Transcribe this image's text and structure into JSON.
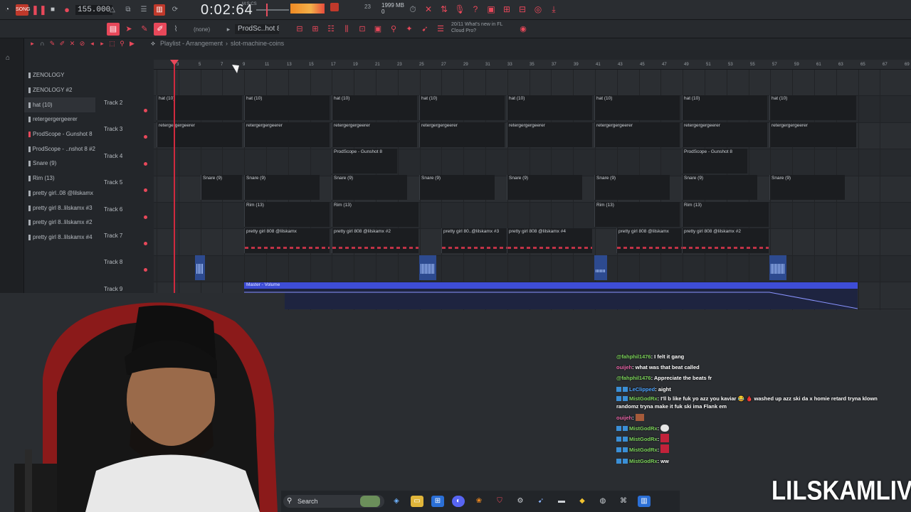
{
  "transport": {
    "tempo": "155.000",
    "time": "0:02:64",
    "time_sub": "M:S:CS",
    "cpu_num": "23",
    "ram": "1999 MB",
    "ram_sub": "0"
  },
  "toolbar": {
    "snap": "(none)",
    "pattern": "ProdSc..hot 8",
    "news_line1": "20/11  What's new in FL",
    "news_line2": "Cloud Pro?"
  },
  "playlist": {
    "title": "Playlist - Arrangement",
    "arrangement": "slot-machine-coins"
  },
  "browser": {
    "items": [
      "ZENOLOGY",
      "ZENOLOGY #2",
      "hat (10)",
      "retergergerg­eerer",
      "ProdScope - Gunshot 8",
      "ProdScope - ..nshot 8 #2",
      "Snare (9)",
      "Rim (13)",
      "pretty girl..08 @lilskamx",
      "pretty girl 8..lilskamx #3",
      "pretty girl 8..lilskamx #2",
      "pretty girl 8..lilskamx #4"
    ]
  },
  "ruler": [
    "3",
    "5",
    "7",
    "9",
    "11",
    "13",
    "15",
    "17",
    "19",
    "21",
    "23",
    "25",
    "27",
    "29",
    "31",
    "33",
    "35",
    "37",
    "39",
    "41",
    "43",
    "45",
    "47",
    "49",
    "51",
    "53",
    "55",
    "57",
    "59",
    "61",
    "63",
    "65",
    "67",
    "69"
  ],
  "tracks": [
    {
      "name": "Track 2"
    },
    {
      "name": "Track 3"
    },
    {
      "name": "Track 4"
    },
    {
      "name": "Track 5"
    },
    {
      "name": "Track 6"
    },
    {
      "name": "Track 7"
    },
    {
      "name": "Track 8"
    },
    {
      "name": "Track 9"
    }
  ],
  "clips": {
    "hat": "hat (10)",
    "reter": "retergergergeerer",
    "prod": "ProdScope - Gunshot 8",
    "snare": "Snare (9)",
    "rim": "Rim (13)",
    "pg1": "pretty girl 808 @lilskamx",
    "pg2": "pretty girl 808 @lilskamx #2",
    "pg3": "pretty girl 80..@lilskamx #3",
    "pg4": "pretty girl 808 @lilskamx #4",
    "auto": "Master - Volume"
  },
  "chat": {
    "l0_user": "@fahphil1476",
    "l0_msg": ": I felt it gang",
    "l1_user": "ouijeh",
    "l1_msg": ": what was that beat called",
    "l2_user": "@fahphil1476",
    "l2_msg": ": Appreciate the beats fr",
    "l3_user": "LeClipped",
    "l3_msg": ": aight",
    "l4_user": "MistGodRx",
    "l4_msg": ": I'll b like fuk yo azz you kaviar 😂 🩸 washed up azz ski da x homie retard tryna klown randomz tryna make it fuk ski ima Flank em",
    "l5_user": "ouijeh",
    "l5_msg": ":",
    "l6_user": "MistGodRx",
    "l6_msg": ":",
    "l7_user": "MistGodRx",
    "l7_msg": ":",
    "l8_user": "MistGodRx",
    "l8_msg": ":",
    "l9_user": "MistGodRx",
    "l9_msg": ": ww"
  },
  "brand": "LILSKAMLIVE",
  "taskbar": {
    "search_label": "Search"
  },
  "colors": {
    "accent": "#e8485a",
    "automation": "#3e4dd6",
    "audio_clip": "#2d4a8f"
  }
}
